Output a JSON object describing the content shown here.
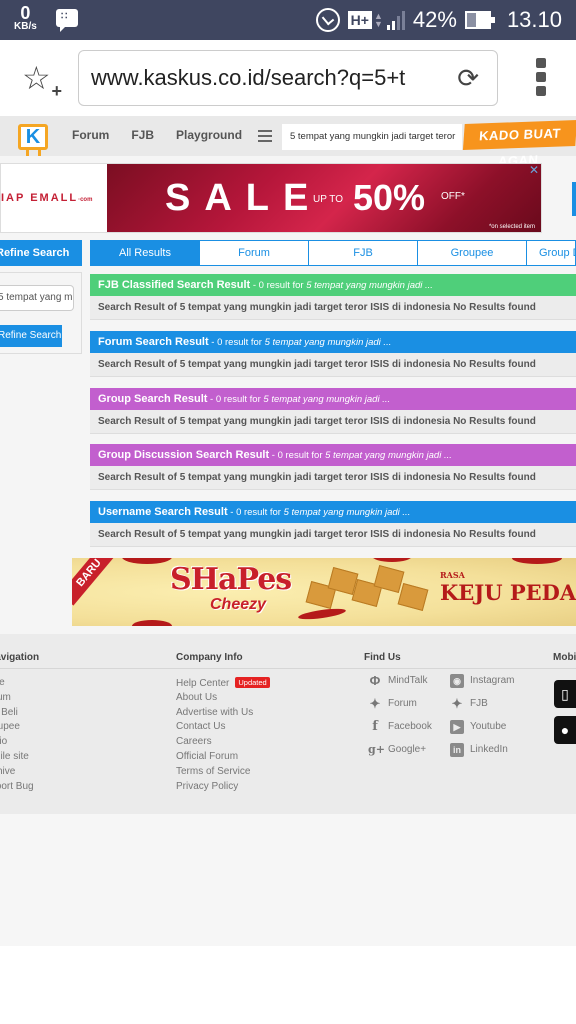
{
  "status_bar": {
    "net_speed": "0",
    "net_unit": "KB/s",
    "network_type": "H+",
    "battery_percent": "42%",
    "battery_level": 0.42,
    "time": "13.10",
    "icons": [
      "bbm-icon",
      "alarm-icon",
      "signal-icon",
      "battery-icon"
    ]
  },
  "browser": {
    "url": "www.kaskus.co.id/search?q=5+t",
    "bookmark_icon": "star-plus-icon",
    "reload_icon": "reload-icon",
    "menu_icon": "overflow-menu-icon"
  },
  "site_header": {
    "logo": "K",
    "nav": [
      "Forum",
      "FJB",
      "Playground"
    ],
    "search_value": "5 tempat yang mungkin jadi target teror",
    "promo_label": "KADO BUAT AGAN"
  },
  "ad_top": {
    "brand": "IAP EMALL",
    "brand_suffix": "·com",
    "sale": "SALE",
    "upto": "UP TO",
    "percent": "50%",
    "off": "OFF*",
    "note": "*on selected item",
    "close": "✕"
  },
  "refine": {
    "header": "Refine Search",
    "input_value": "5 tempat yang mungkin",
    "button": "Refine Search"
  },
  "tabs": [
    {
      "label": "All Results",
      "active": true
    },
    {
      "label": "Forum",
      "active": false
    },
    {
      "label": "FJB",
      "active": false
    },
    {
      "label": "Groupee",
      "active": false
    },
    {
      "label": "Group Discussion",
      "active": false
    }
  ],
  "results": [
    {
      "title": "FJB Classified Search Result",
      "count_text": " - 0 result for ",
      "query": "5 tempat yang mungkin jadi ...",
      "body": "Search Result of 5 tempat yang mungkin jadi target teror ISIS di indonesia No Results found",
      "color": "#4fcf7a"
    },
    {
      "title": "Forum Search Result",
      "count_text": " - 0 result for ",
      "query": "5 tempat yang mungkin jadi ...",
      "body": "Search Result of 5 tempat yang mungkin jadi target teror ISIS di indonesia No Results found",
      "color": "#1a8fe3"
    },
    {
      "title": "Group Search Result",
      "count_text": " - 0 result for ",
      "query": "5 tempat yang mungkin jadi ...",
      "body": "Search Result of 5 tempat yang mungkin jadi target teror ISIS di indonesia No Results found",
      "color": "#c25fce"
    },
    {
      "title": "Group Discussion Search Result",
      "count_text": " - 0 result for ",
      "query": "5 tempat yang mungkin jadi ...",
      "body": "Search Result of 5 tempat yang mungkin jadi target teror ISIS di indonesia No Results found",
      "color": "#c25fce"
    },
    {
      "title": "Username Search Result",
      "count_text": " - 0 result for ",
      "query": "5 tempat yang mungkin jadi ...",
      "body": "Search Result of 5 tempat yang mungkin jadi target teror ISIS di indonesia No Results found",
      "color": "#1a8fe3"
    }
  ],
  "ad_bottom": {
    "baru": "BARU",
    "brand": "SHaPes",
    "variant": "Cheezy",
    "rasa": "RASA",
    "flavor": "KEJU PEDAS"
  },
  "footer": {
    "navigation": {
      "title": "Navigation",
      "items": [
        "Home",
        "Forum",
        "Jual Beli",
        "Groupee",
        "Radio",
        "Mobile site",
        "Archive",
        "Report Bug"
      ]
    },
    "company": {
      "title": "Company Info",
      "items": [
        "Help Center",
        "About Us",
        "Advertise with Us",
        "Contact Us",
        "Careers",
        "Official Forum",
        "Terms of Service",
        "Privacy Policy"
      ],
      "badge": "Updated"
    },
    "find_us": {
      "title": "Find Us",
      "items": [
        {
          "label": "MindTalk",
          "icon": "mindtalk-icon"
        },
        {
          "label": "Instagram",
          "icon": "instagram-icon"
        },
        {
          "label": "Forum",
          "icon": "twitter-icon"
        },
        {
          "label": "FJB",
          "icon": "twitter-icon"
        },
        {
          "label": "Facebook",
          "icon": "facebook-icon"
        },
        {
          "label": "Youtube",
          "icon": "youtube-icon"
        },
        {
          "label": "Google+",
          "icon": "google-plus-icon"
        },
        {
          "label": "LinkedIn",
          "icon": "linkedin-icon"
        }
      ]
    },
    "mobile": {
      "title": "Mobile App"
    }
  }
}
